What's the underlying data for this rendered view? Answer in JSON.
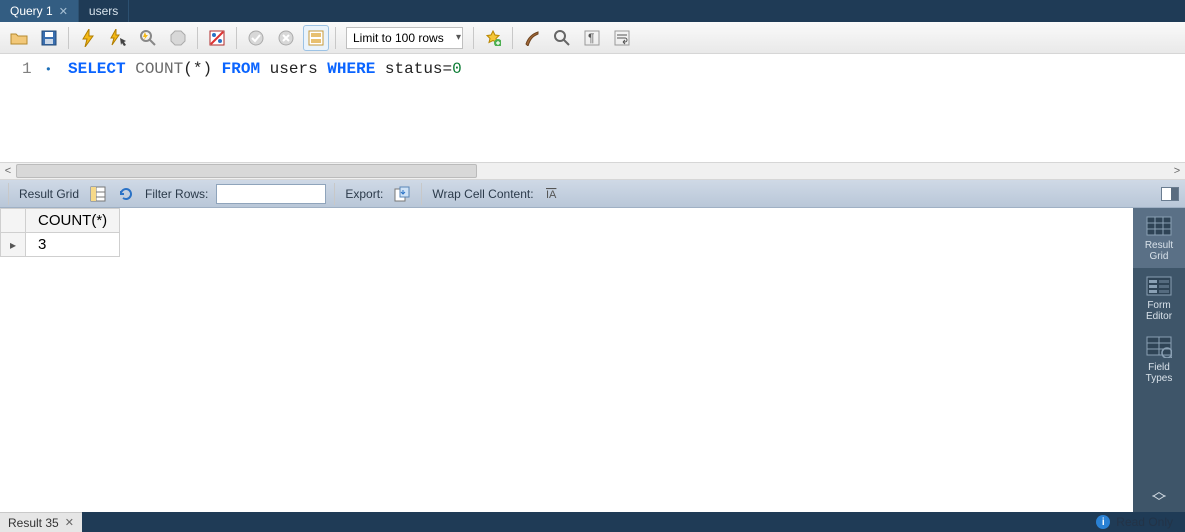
{
  "tabs": [
    {
      "label": "Query 1",
      "closable": true,
      "active": true
    },
    {
      "label": "users",
      "closable": false,
      "active": false
    }
  ],
  "toolbar": {
    "limit_label": "Limit to 100 rows"
  },
  "editor": {
    "line_number": "1",
    "sql": {
      "select": "SELECT",
      "count": "COUNT",
      "star": "(*)",
      "from": "FROM",
      "table": "users",
      "where": "WHERE",
      "col": "status",
      "eq": "=",
      "val": "0"
    }
  },
  "result_toolbar": {
    "title": "Result Grid",
    "filter_label": "Filter Rows:",
    "filter_value": "",
    "export_label": "Export:",
    "wrap_label": "Wrap Cell Content:"
  },
  "result_grid": {
    "columns": [
      "COUNT(*)"
    ],
    "rows": [
      {
        "cells": [
          "3"
        ]
      }
    ]
  },
  "side_tabs": [
    {
      "label": "Result\nGrid",
      "name": "result-grid",
      "active": true
    },
    {
      "label": "Form\nEditor",
      "name": "form-editor",
      "active": false
    },
    {
      "label": "Field\nTypes",
      "name": "field-types",
      "active": false
    }
  ],
  "bottom": {
    "tab_label": "Result 35",
    "status_text": "Read Only"
  }
}
